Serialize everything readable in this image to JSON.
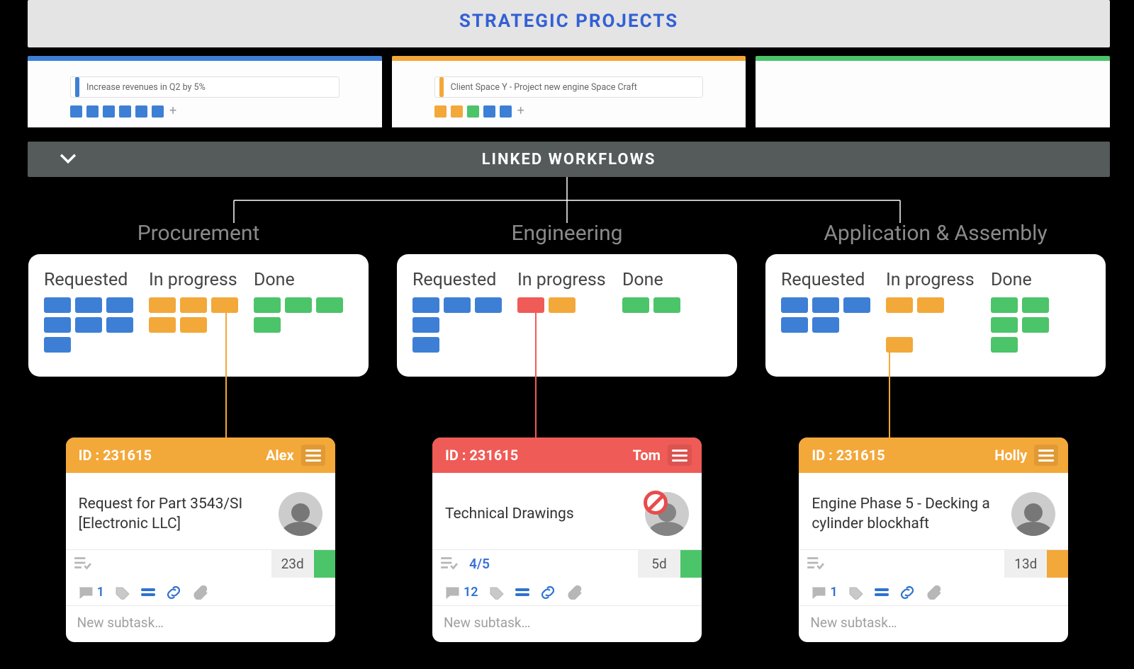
{
  "header": {
    "title": "STRATEGIC PROJECTS"
  },
  "lanes": {
    "blue": {
      "color": "#3e7fd6",
      "project_label": "Increase revenues in Q2 by 5%",
      "chips": [
        "blue",
        "blue",
        "blue",
        "blue",
        "blue",
        "blue"
      ]
    },
    "orange": {
      "color": "#f3a83a",
      "project_label": "Client Space Y - Project new engine Space Craft",
      "chips": [
        "orange",
        "orange",
        "green",
        "blue",
        "blue"
      ]
    },
    "green": {
      "color": "#4cc46a"
    }
  },
  "linked": {
    "title": "LINKED WORKFLOWS"
  },
  "boards": [
    {
      "name": "Procurement",
      "columns": [
        {
          "name": "Requested",
          "rows": [
            [
              "blue",
              "blue",
              "blue"
            ],
            [
              "blue",
              "blue",
              "blue"
            ],
            [
              "blue"
            ]
          ]
        },
        {
          "name": "In progress",
          "rows": [
            [
              "orange",
              "orange",
              "orange"
            ],
            [
              "orange",
              "orange"
            ]
          ]
        },
        {
          "name": "Done",
          "rows": [
            [
              "green",
              "green",
              "green"
            ],
            [
              "green"
            ]
          ]
        }
      ],
      "link_color": "#f3a83a",
      "task": {
        "head_color": "#f3a83a",
        "id": "ID : 231615",
        "assignee": "Alex",
        "title": "Request for Part 3543/SI [Electronic LLC]",
        "progress": "",
        "days": "23d",
        "bar_color": "#4cc46a",
        "comments": "1",
        "subtask": "New subtask…",
        "blocked": false
      }
    },
    {
      "name": "Engineering",
      "columns": [
        {
          "name": "Requested",
          "rows": [
            [
              "blue",
              "blue",
              "blue"
            ],
            [
              "blue"
            ],
            [
              "blue"
            ]
          ]
        },
        {
          "name": "In progress",
          "rows": [
            [
              "red",
              "orange"
            ]
          ]
        },
        {
          "name": "Done",
          "rows": [
            [
              "green",
              "green"
            ]
          ]
        }
      ],
      "link_color": "#ef5b56",
      "task": {
        "head_color": "#ef5b56",
        "id": "ID : 231615",
        "assignee": "Tom",
        "title": "Technical Drawings",
        "progress": "4/5",
        "days": "5d",
        "bar_color": "#4cc46a",
        "comments": "12",
        "subtask": "New subtask…",
        "blocked": true
      }
    },
    {
      "name": "Application & Assembly",
      "columns": [
        {
          "name": "Requested",
          "rows": [
            [
              "blue",
              "blue",
              "blue"
            ],
            [
              "blue",
              "blue"
            ]
          ]
        },
        {
          "name": "In progress",
          "rows": [
            [
              "orange",
              "orange"
            ],
            [
              ""
            ],
            [
              "orange"
            ]
          ]
        },
        {
          "name": "Done",
          "rows": [
            [
              "green",
              "green"
            ],
            [
              "green",
              "green"
            ],
            [
              "green"
            ]
          ]
        }
      ],
      "link_color": "#f3a83a",
      "task": {
        "head_color": "#f3a83a",
        "id": "ID : 231615",
        "assignee": "Holly",
        "title": "Engine Phase 5 - Decking a cylinder blockhaft",
        "progress": "",
        "days": "13d",
        "bar_color": "#f3a83a",
        "comments": "1",
        "subtask": "New subtask…",
        "blocked": false
      }
    }
  ]
}
